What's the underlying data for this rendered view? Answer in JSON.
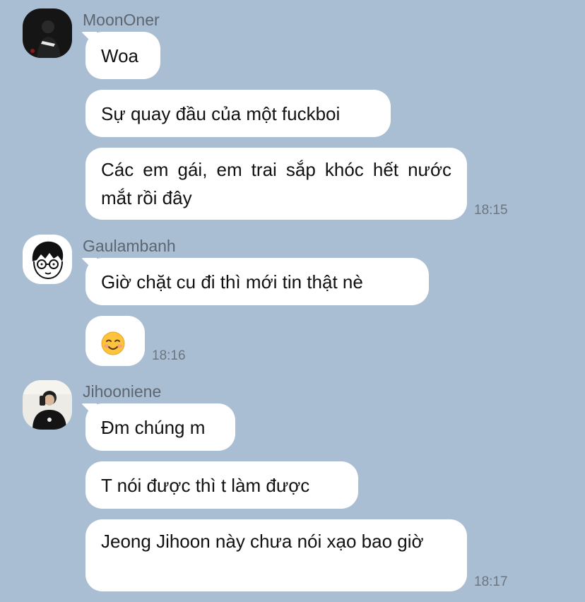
{
  "messages": [
    {
      "sender": "MoonOner",
      "avatar": "avatar-dark-photo",
      "bubbles": [
        "Woa",
        "Sự quay đầu của một fuckboi",
        "Các em gái, em trai sắp khóc hết nước mắt rồi đây"
      ],
      "time": "18:15"
    },
    {
      "sender": "Gaulambanh",
      "avatar": "avatar-cartoon-glasses",
      "bubbles": [
        "Giờ chặt cu đi thì mới tin thật nè",
        "☺️"
      ],
      "time": "18:16"
    },
    {
      "sender": "Jihooniene",
      "avatar": "avatar-mirror-selfie",
      "bubbles": [
        "Đm chúng m",
        "T nói được thì t làm được",
        "Jeong Jihoon này chưa nói xạo bao giờ"
      ],
      "time": "18:17"
    }
  ],
  "colors": {
    "background": "#a9bed2",
    "bubble": "#ffffff",
    "sender_text": "#5d6670",
    "time_text": "#6b7680"
  },
  "icons": {
    "emoji": "smiling-face-emoji"
  }
}
